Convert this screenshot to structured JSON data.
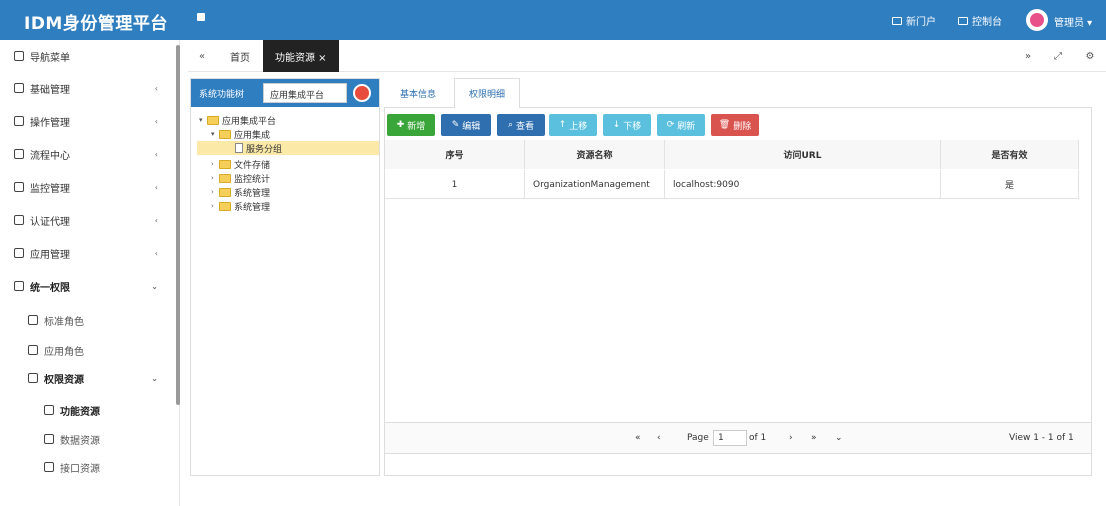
{
  "app": {
    "title": "IDM身份管理平台"
  },
  "header": {
    "portal_label": "新门户",
    "console_label": "控制台",
    "user_label": "管理员 ▾"
  },
  "sidebar": {
    "items": [
      {
        "label": "导航菜单"
      },
      {
        "label": "基础管理"
      },
      {
        "label": "操作管理"
      },
      {
        "label": "流程中心"
      },
      {
        "label": "监控管理"
      },
      {
        "label": "认证代理"
      },
      {
        "label": "应用管理"
      },
      {
        "label": "统一权限"
      },
      {
        "label": "标准角色"
      },
      {
        "label": "应用角色"
      },
      {
        "label": "权限资源"
      },
      {
        "label": "功能资源"
      },
      {
        "label": "数据资源"
      },
      {
        "label": "接口资源"
      }
    ]
  },
  "tabs": {
    "back": "«",
    "home": "首页",
    "active": "功能资源 ×",
    "forward": "»",
    "fullscreen": "⤢",
    "settings": "⚙"
  },
  "tree": {
    "header_label": "系统功能树",
    "selector_value": "应用集成平台",
    "nodes": [
      {
        "label": "应用集成平台"
      },
      {
        "label": "应用集成"
      },
      {
        "label": "服务分组"
      },
      {
        "label": "文件存储"
      },
      {
        "label": "监控统计"
      },
      {
        "label": "系统管理"
      },
      {
        "label": "系统管理"
      }
    ]
  },
  "right_tabs": {
    "basic": "基本信息",
    "detail": "权限明细"
  },
  "toolbar": {
    "add": "新增",
    "edit": "编辑",
    "query": "查看",
    "up": "上移",
    "down": "下移",
    "refresh": "刷新",
    "delete": "删除",
    "add_color": "#3aa63a",
    "edit_color": "#2f6fb0",
    "query_color": "#2f6fb0",
    "up_color": "#5bc0de",
    "down_color": "#5bc0de",
    "refresh_color": "#5bc0de",
    "delete_color": "#d9534f"
  },
  "grid": {
    "headers": [
      "序号",
      "资源名称",
      "访问URL",
      "是否有效"
    ],
    "rows": [
      [
        "1",
        "OrganizationManagement",
        "localhost:9090",
        "是"
      ]
    ]
  },
  "pager": {
    "first": "«",
    "prev": "‹",
    "page_label": "Page",
    "page_value": "1",
    "of": "of 1",
    "next": "›",
    "last": "»",
    "size": "⌄",
    "view": "View 1 - 1 of 1"
  }
}
